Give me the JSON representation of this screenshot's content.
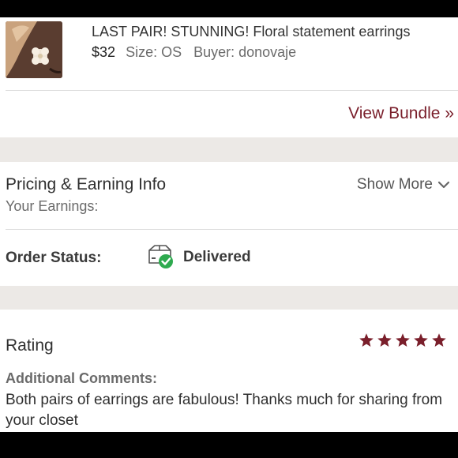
{
  "item": {
    "title": "LAST PAIR! STUNNING! Floral statement earrings",
    "price": "$32",
    "size": "Size: OS",
    "buyer": "Buyer: donovaje",
    "thumbnail_icon": "earring-photo"
  },
  "bundle": {
    "view_label": "View Bundle »"
  },
  "pricing": {
    "title": "Pricing & Earning Info",
    "earnings_label": "Your Earnings:",
    "show_more_label": "Show More",
    "show_more_icon": "chevron-down-icon"
  },
  "order": {
    "status_label": "Order Status:",
    "status_value": "Delivered",
    "status_icon": "delivered-box-icon",
    "status_color": "#2eaa4f"
  },
  "rating": {
    "title": "Rating",
    "stars": 5,
    "max_stars": 5,
    "star_color": "#7a1f2b",
    "comments_label": "Additional Comments:",
    "comments_text": "Both pairs of earrings are fabulous! Thanks much for sharing from your closet"
  },
  "colors": {
    "accent": "#7a1f2b",
    "band": "#ece9e6"
  }
}
